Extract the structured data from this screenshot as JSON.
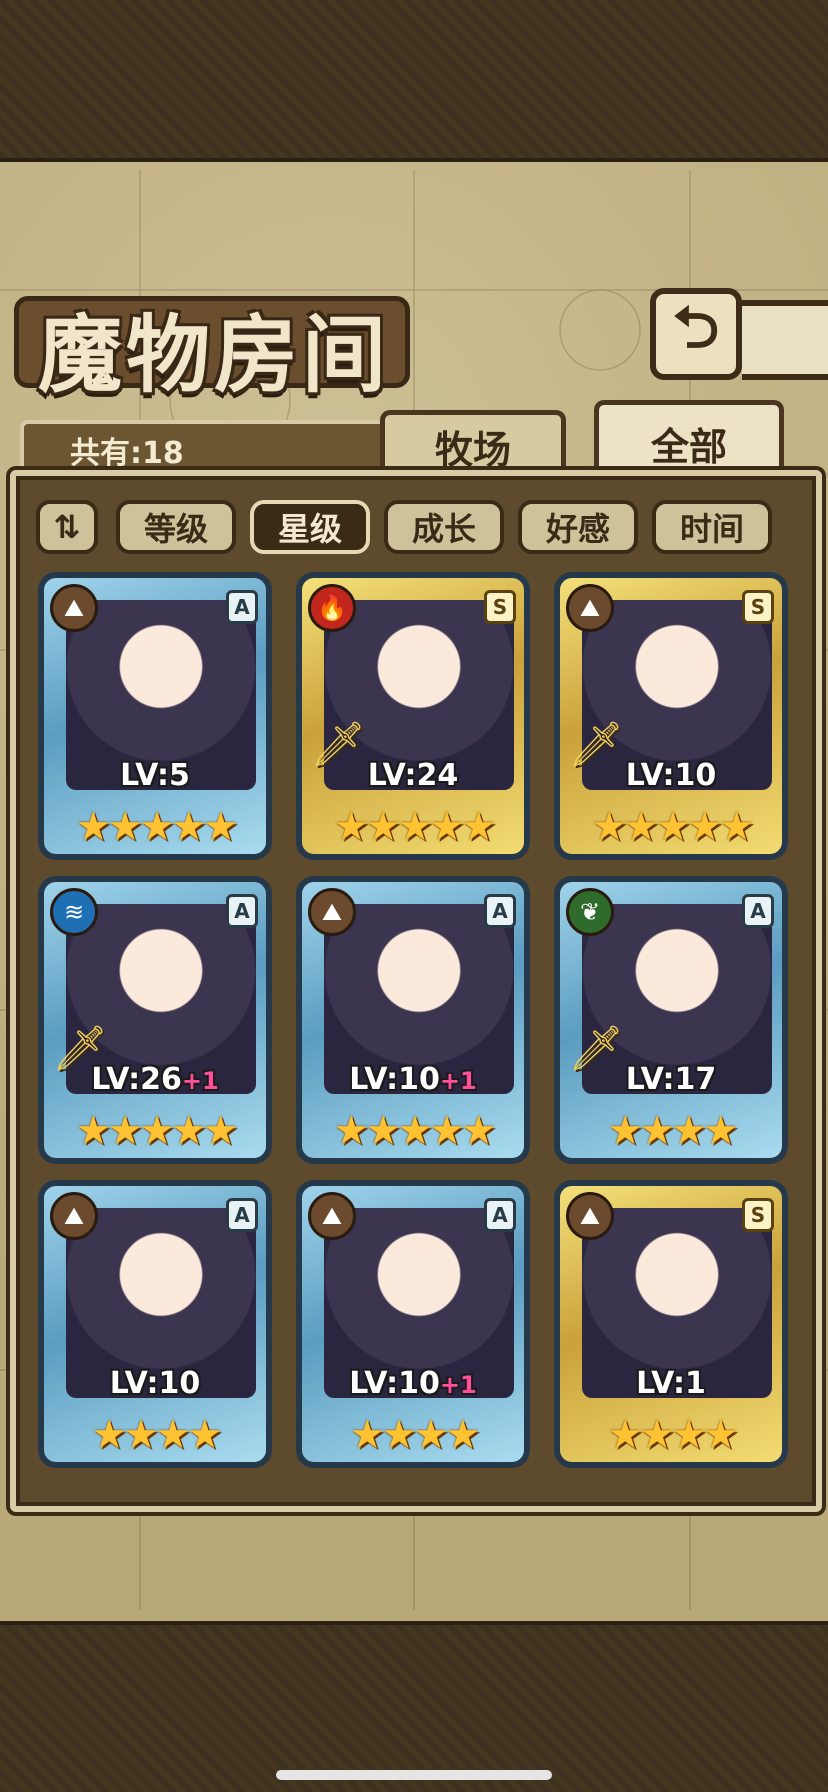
{
  "header": {
    "title": "魔物房间"
  },
  "back_button": {
    "icon": "return-arrow-icon",
    "glyph": "⮌"
  },
  "monster_count": "共有:18",
  "tabs": [
    {
      "label": "牧场",
      "active": false
    },
    {
      "label": "全部",
      "active": true
    }
  ],
  "sort_toggle": {
    "icon": "sort-order-icon",
    "glyph": "⇅"
  },
  "filters": [
    {
      "label": "等级",
      "selected": false
    },
    {
      "label": "星级",
      "selected": true
    },
    {
      "label": "成长",
      "selected": false
    },
    {
      "label": "好感",
      "selected": false
    },
    {
      "label": "时间",
      "selected": false
    }
  ],
  "monsters": [
    {
      "element": "earth",
      "elem_color": "#6b4a2e",
      "elem_glyph": "⛰",
      "rank": "A",
      "level": "LV:5",
      "bonus": "",
      "stars": "★★★★★",
      "sword": false
    },
    {
      "element": "fire",
      "elem_color": "#c2271d",
      "elem_glyph": "🔥",
      "rank": "S",
      "level": "LV:24",
      "bonus": "",
      "stars": "★★★★★",
      "sword": true
    },
    {
      "element": "earth",
      "elem_color": "#6b4a2e",
      "elem_glyph": "⛰",
      "rank": "S",
      "level": "LV:10",
      "bonus": "",
      "stars": "★★★★★",
      "sword": true
    },
    {
      "element": "water",
      "elem_color": "#1f6fb5",
      "elem_glyph": "≋",
      "rank": "A",
      "level": "LV:26",
      "bonus": "+1",
      "stars": "★★★★★",
      "sword": true
    },
    {
      "element": "earth",
      "elem_color": "#6b4a2e",
      "elem_glyph": "⛰",
      "rank": "A",
      "level": "LV:10",
      "bonus": "+1",
      "stars": "★★★★★",
      "sword": false
    },
    {
      "element": "wood",
      "elem_color": "#2f6b2a",
      "elem_glyph": "❦",
      "rank": "A",
      "level": "LV:17",
      "bonus": "",
      "stars": "★★★★",
      "sword": true
    },
    {
      "element": "earth",
      "elem_color": "#6b4a2e",
      "elem_glyph": "⛰",
      "rank": "A",
      "level": "LV:10",
      "bonus": "",
      "stars": "★★★★",
      "sword": false
    },
    {
      "element": "earth",
      "elem_color": "#6b4a2e",
      "elem_glyph": "⛰",
      "rank": "A",
      "level": "LV:10",
      "bonus": "+1",
      "stars": "★★★★",
      "sword": false
    },
    {
      "element": "earth",
      "elem_color": "#6b4a2e",
      "elem_glyph": "⛰",
      "rank": "S",
      "level": "LV:1",
      "bonus": "",
      "stars": "★★★★",
      "sword": false
    }
  ]
}
